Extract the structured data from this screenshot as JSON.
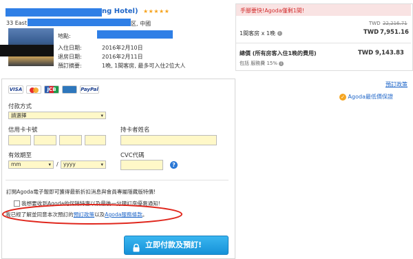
{
  "hotel": {
    "name_visible": "ng Hotel)",
    "stars": "★★★★★",
    "address_start": "33 East",
    "address_end": "区, 中國"
  },
  "booking_details": {
    "address_label": "地點:",
    "checkin_label": "入住日期:",
    "checkin_value": "2016年2月10日",
    "checkout_label": "退房日期:",
    "checkout_value": "2016年2月11日",
    "summary_label": "預訂摘要:",
    "summary_value": "1晚, 1間客房, 最多可入住2位大人"
  },
  "cards": [
    "VISA",
    "MC",
    "JCB",
    "AMEX",
    "PayPal"
  ],
  "payment": {
    "method_label": "付款方式",
    "method_value": "請選擇",
    "card_number_label": "信用卡卡號",
    "holder_label": "持卡者姓名",
    "expiry_label": "有效期至",
    "month_value": "mm",
    "slash": "/",
    "year_value": "yyyy",
    "cvc_label": "CVC代碼",
    "help": "?"
  },
  "subscribe": {
    "newsletter_text": "訂閱Agoda電子報即可獲得最新折扣消息與會員專屬隱藏版特價!",
    "promo_text": "我想要收到Agoda的促銷特惠以及最後一分鐘訂房優惠通知!",
    "agree_prefix": "我已經了解並同意本次預訂的",
    "policy_link": "預訂政策",
    "agree_mid": "以及",
    "terms_link": "Agoda服務條款",
    "agree_suffix": "。"
  },
  "submit_button": "立即付款及預訂!",
  "summary": {
    "urgency": "手腳要快!Agoda僅剩1間!",
    "currency": "TWD",
    "original_price": "22,216.71",
    "room_line": "1間客房 x 1晚",
    "room_price": "7,951.16",
    "total_label": "總價 (所有房客入住1晚的費用)",
    "total_price": "9,143.83",
    "fee_note": "包括 服務費 15%",
    "info": "i",
    "booking_policy_link": "預訂政策",
    "best_price_link": "Agoda最低價保證",
    "best_price_check": "✓"
  },
  "colors": {
    "accent_blue": "#1f66c8",
    "button_blue": "#1aa0e6",
    "field_yellow": "#fff8c8",
    "urgency_bg": "#f9e3e3",
    "urgency_text": "#d22c2c",
    "star_orange": "#f6a21a",
    "highlight_red": "#e0271d"
  }
}
